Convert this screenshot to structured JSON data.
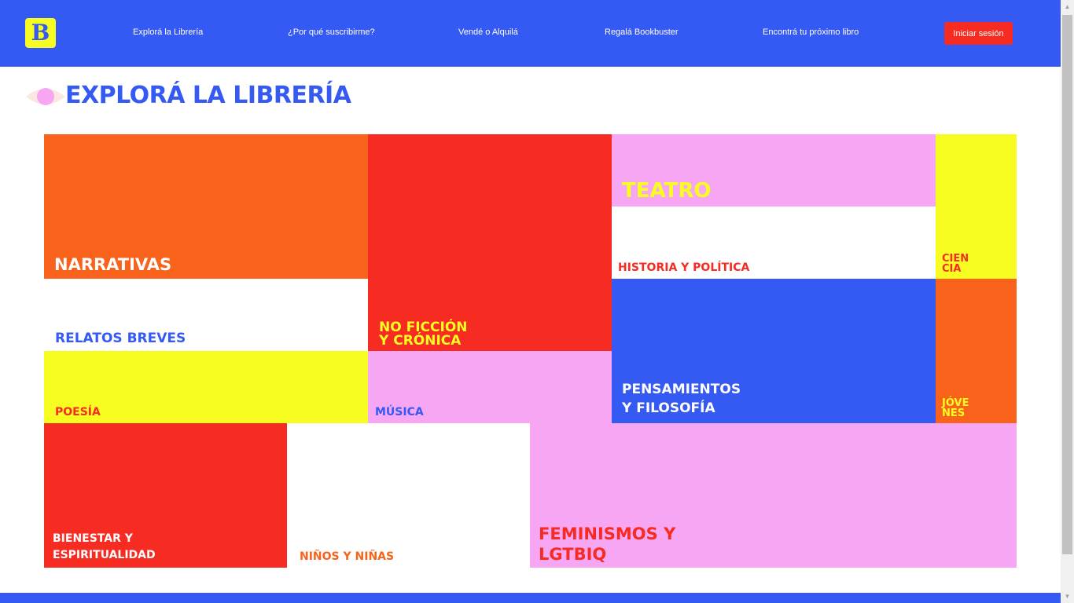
{
  "header": {
    "logo_letter": "B",
    "nav": [
      {
        "label": "Explorá la Librería"
      },
      {
        "label": "¿Por qué suscribirme?"
      },
      {
        "label": "Vendé o Alquilá"
      },
      {
        "label": "Regalá Bookbuster"
      },
      {
        "label": "Encontrá tu próximo libro"
      }
    ],
    "login_label": "Iniciar sesión"
  },
  "main": {
    "title": "EXPLORÁ LA LIBRERÍA",
    "tiles": [
      {
        "label": "NARRATIVAS",
        "bg": "#f8621a",
        "color": "#ffffff"
      },
      {
        "label": "NO FICCIÓN\nY CRÓNICA",
        "bg": "#f62b22",
        "color": "#f7fd21"
      },
      {
        "label": "TEATRO",
        "bg": "#f7a6f4",
        "color": "#f7fd21"
      },
      {
        "label": "HISTORIA Y POLÍTICA",
        "bg": "#ffffff",
        "color": "#f62b22"
      },
      {
        "label": "CIEN\nCIA",
        "bg": "#f7fd21",
        "color": "#f62b22"
      },
      {
        "label": "RELATOS BREVES",
        "bg": "#ffffff",
        "color": "#3559f3"
      },
      {
        "label": "PENSAMIENTOS\nY FILOSOFÍA",
        "bg": "#3559f3",
        "color": "#ffffff"
      },
      {
        "label": "JÓVE\nNES",
        "bg": "#f8621a",
        "color": "#f7fd21"
      },
      {
        "label": "POESÍA",
        "bg": "#f7fd21",
        "color": "#f62b22"
      },
      {
        "label": "MÚSICA",
        "bg": "#f7a6f4",
        "color": "#3559f3"
      },
      {
        "label": "BIENESTAR Y\nESPIRITUALIDAD",
        "bg": "#f62b22",
        "color": "#ffffff"
      },
      {
        "label": "NIÑOS Y NIÑAS",
        "bg": "#ffffff",
        "color": "#f8621a"
      },
      {
        "label": "FEMINISMOS Y\nLGTBIQ",
        "bg": "#f7a6f4",
        "color": "#f62b22"
      }
    ]
  },
  "colors": {
    "brand_blue": "#3559f3",
    "brand_yellow": "#f7fd21",
    "brand_red": "#f62b22",
    "brand_orange": "#f8621a",
    "brand_pink": "#f7a6f4"
  },
  "icons": {
    "eye": "eye-icon"
  }
}
